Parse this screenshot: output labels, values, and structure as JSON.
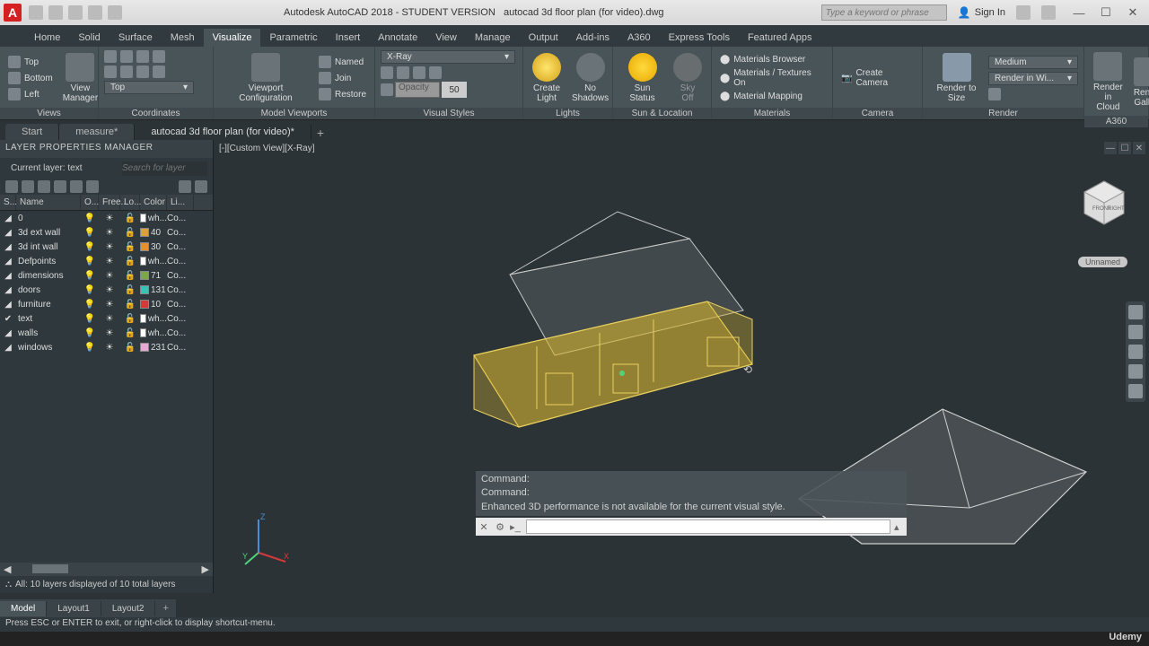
{
  "titlebar": {
    "app": "Autodesk AutoCAD 2018 - STUDENT VERSION",
    "file": "autocad 3d floor plan (for video).dwg",
    "search_placeholder": "Type a keyword or phrase",
    "signin": "Sign In"
  },
  "ribbon_tabs": [
    "Home",
    "Solid",
    "Surface",
    "Mesh",
    "Visualize",
    "Parametric",
    "Insert",
    "Annotate",
    "View",
    "Manage",
    "Output",
    "Add-ins",
    "A360",
    "Express Tools",
    "Featured Apps"
  ],
  "ribbon_active": "Visualize",
  "panels": {
    "views": {
      "title": "Views",
      "items": [
        "Top",
        "Bottom",
        "Left"
      ],
      "btn": "View\nManager"
    },
    "coords": {
      "title": "Coordinates",
      "dropdown": "Top"
    },
    "viewports": {
      "title": "Model Viewports",
      "btn": "Viewport\nConfiguration",
      "named": "Named",
      "join": "Join",
      "restore": "Restore"
    },
    "visual": {
      "title": "Visual Styles",
      "dropdown": "X-Ray",
      "opacity_label": "Opacity",
      "opacity_val": "50"
    },
    "lights": {
      "title": "Lights",
      "btn": "Create\nLight",
      "shadows": "No\nShadows"
    },
    "sun": {
      "title": "Sun & Location",
      "btn": "Sun\nStatus",
      "sky": "Sky Off"
    },
    "materials": {
      "title": "Materials",
      "browser": "Materials Browser",
      "textures": "Materials / Textures On",
      "mapping": "Material Mapping"
    },
    "camera": {
      "title": "Camera",
      "btn": "Create Camera"
    },
    "render": {
      "title": "Render",
      "size": "Render to Size",
      "quality": "Medium",
      "dest": "Render in Wi...",
      "cloud": "Render in\nCloud",
      "gallery": "Render\nGallery"
    },
    "a360": {
      "title": "A360"
    }
  },
  "doc_tabs": [
    "Start",
    "measure*",
    "autocad 3d floor plan (for video)*"
  ],
  "doc_active": 2,
  "layer_panel": {
    "title": "LAYER PROPERTIES MANAGER",
    "current": "Current layer: text",
    "search": "Search for layer",
    "headers": [
      "S...",
      "Name",
      "O...",
      "Free...",
      "Lo...",
      "Color",
      "Li..."
    ],
    "footer": "All: 10 layers displayed of 10 total layers",
    "rows": [
      {
        "name": "0",
        "on": "💡",
        "freeze": "☀",
        "lock": "🔓",
        "colorName": "wh...",
        "color": "#ffffff",
        "lt": "Co..."
      },
      {
        "name": "3d ext wall",
        "on": "💡",
        "freeze": "☀",
        "lock": "🔓",
        "colorName": "40",
        "color": "#d9a23a",
        "lt": "Co..."
      },
      {
        "name": "3d int wall",
        "on": "💡",
        "freeze": "☀",
        "lock": "🔓",
        "colorName": "30",
        "color": "#e88f2e",
        "lt": "Co..."
      },
      {
        "name": "Defpoints",
        "on": "💡",
        "freeze": "☀",
        "lock": "🔓",
        "colorName": "wh...",
        "color": "#ffffff",
        "lt": "Co..."
      },
      {
        "name": "dimensions",
        "on": "💡",
        "freeze": "☀",
        "lock": "🔓",
        "colorName": "71",
        "color": "#7aa84a",
        "lt": "Co..."
      },
      {
        "name": "doors",
        "on": "💡",
        "freeze": "☀",
        "lock": "🔓",
        "colorName": "131",
        "color": "#3ac2b8",
        "lt": "Co..."
      },
      {
        "name": "furniture",
        "on": "💡",
        "freeze": "☀",
        "lock": "🔓",
        "colorName": "10",
        "color": "#d43a3a",
        "lt": "Co..."
      },
      {
        "name": "text",
        "on": "💡",
        "freeze": "☀",
        "lock": "🔓",
        "colorName": "wh...",
        "color": "#ffffff",
        "lt": "Co...",
        "current": true
      },
      {
        "name": "walls",
        "on": "💡",
        "freeze": "☀",
        "lock": "🔓",
        "colorName": "wh...",
        "color": "#ffffff",
        "lt": "Co..."
      },
      {
        "name": "windows",
        "on": "💡",
        "freeze": "☀",
        "lock": "🔓",
        "colorName": "231",
        "color": "#e6a8d4",
        "lt": "Co..."
      }
    ]
  },
  "viewport": {
    "label": "[-][Custom View][X-Ray]",
    "unnamed": "Unnamed"
  },
  "command": {
    "lines": [
      "Command:",
      "Command:",
      "Enhanced 3D performance is not available for the current visual style."
    ]
  },
  "bottom_tabs": [
    "Model",
    "Layout1",
    "Layout2"
  ],
  "bottom_active": 0,
  "status": "Press ESC or ENTER to exit, or right-click to display shortcut-menu.",
  "watermark": "Udemy"
}
